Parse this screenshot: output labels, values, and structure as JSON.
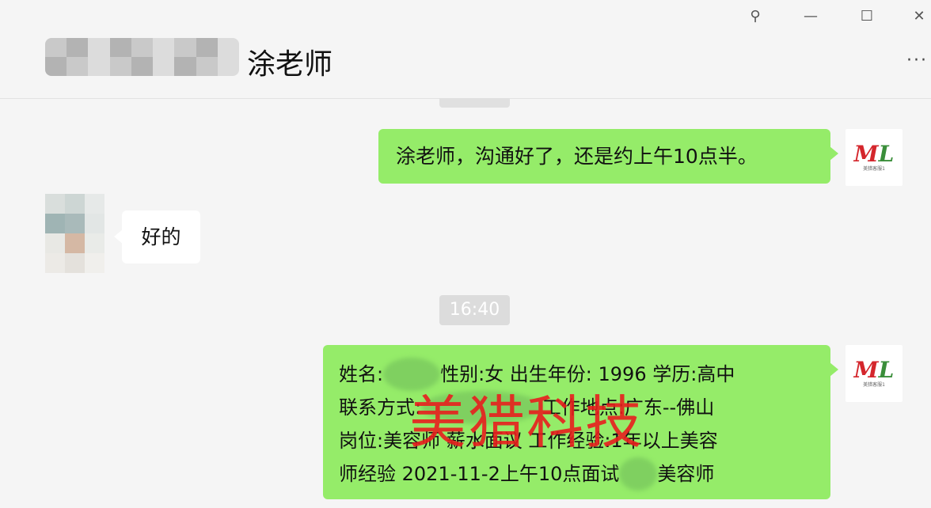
{
  "window": {
    "pin_glyph": "⚲",
    "minimize_glyph": "—",
    "maximize_glyph": "☐",
    "close_glyph": "✕"
  },
  "header": {
    "title": "涂老师",
    "more_glyph": "···"
  },
  "messages": [
    {
      "from": "self",
      "text": "涂老师，沟通好了，还是约上午10点半。"
    },
    {
      "from": "other",
      "text": "好的"
    }
  ],
  "timestamp": "16:40",
  "resume": {
    "line1_a": "姓名:",
    "line1_b": "性别:女 出生年份: 1996 学历:高中",
    "line2_a": "联系方式:",
    "line2_b": "工作地点:广东--佛山",
    "line3": "岗位:美容师 薪水面议 工作经验:1年以上美容",
    "line4_a": "师经验 2021-11-2上午10点面试",
    "line4_b": "美容师"
  },
  "watermark": "美猎科技",
  "avatar_self": {
    "logo_m": "M",
    "logo_l": "L",
    "caption": "美猎客服1"
  },
  "colors": {
    "bubble_self": "#95ec69",
    "bubble_other": "#ffffff",
    "watermark": "#e81e1e",
    "background": "#f5f5f5"
  }
}
